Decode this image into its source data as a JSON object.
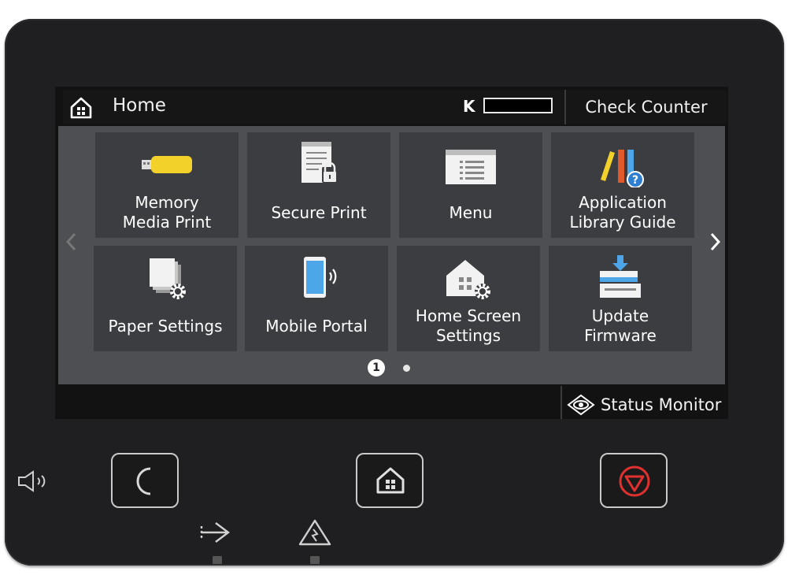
{
  "header": {
    "title": "Home",
    "toner_label": "K",
    "check_counter_label": "Check Counter"
  },
  "tiles": [
    {
      "label": "Memory\nMedia Print",
      "icon": "usb-memory-icon"
    },
    {
      "label": "Secure Print",
      "icon": "secure-print-lock-icon"
    },
    {
      "label": "Menu",
      "icon": "menu-list-icon"
    },
    {
      "label": "Application\nLibrary Guide",
      "icon": "library-guide-icon"
    },
    {
      "label": "Paper Settings",
      "icon": "paper-settings-gear-icon"
    },
    {
      "label": "Mobile Portal",
      "icon": "mobile-portal-icon"
    },
    {
      "label": "Home Screen\nSettings",
      "icon": "home-settings-gear-icon"
    },
    {
      "label": "Update\nFirmware",
      "icon": "update-firmware-icon"
    }
  ],
  "pager": {
    "current": "1",
    "total_pages": 2
  },
  "status": {
    "label": "Status Monitor"
  },
  "colors": {
    "device_body": "#1f1f21",
    "content_bg": "#4e4f52",
    "tile_bg": "#3c3d40",
    "stop_red": "#e0312f",
    "usb_yellow": "#f2d22a"
  }
}
